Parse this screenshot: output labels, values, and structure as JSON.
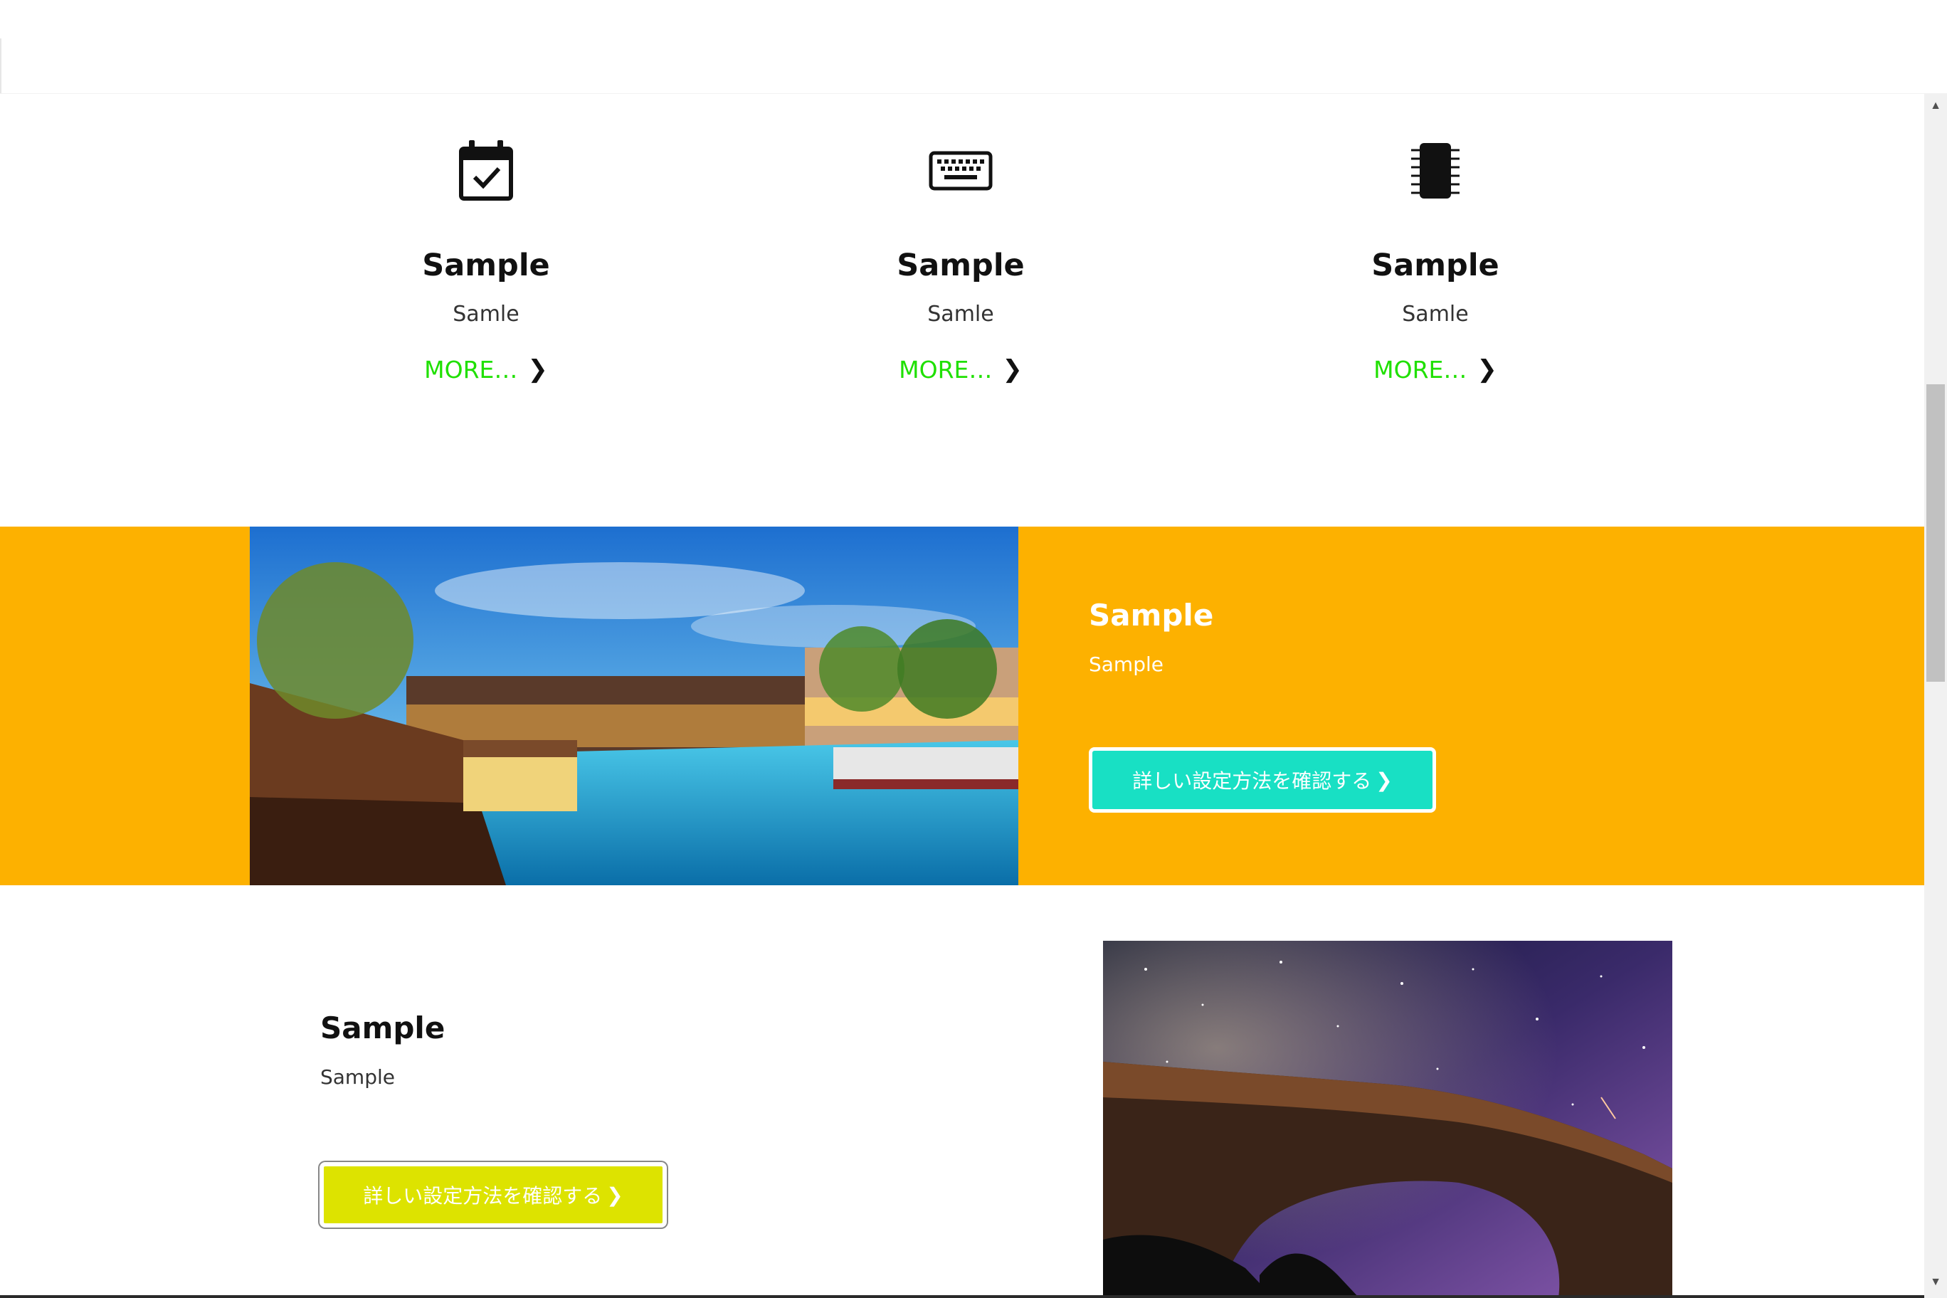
{
  "features": [
    {
      "icon": "calendar-check-icon",
      "title": "Sample",
      "desc": "Samle",
      "more": "MORE…"
    },
    {
      "icon": "keyboard-icon",
      "title": "Sample",
      "desc": "Samle",
      "more": "MORE…"
    },
    {
      "icon": "memory-chip-icon",
      "title": "Sample",
      "desc": "Samle",
      "more": "MORE…"
    }
  ],
  "band": {
    "title": "Sample",
    "desc": "Sample",
    "button_label": "詳しい設定方法を確認する",
    "photo": "canal-city-night-photo",
    "bg_color": "#fdb100",
    "button_color": "#18e0c4"
  },
  "lower": {
    "title": "Sample",
    "desc": "Sample",
    "button_label": "詳しい設定方法を確認する",
    "photo": "starry-sky-arch-photo",
    "button_color": "#dde300"
  },
  "colors": {
    "more_link": "#1fe000"
  }
}
